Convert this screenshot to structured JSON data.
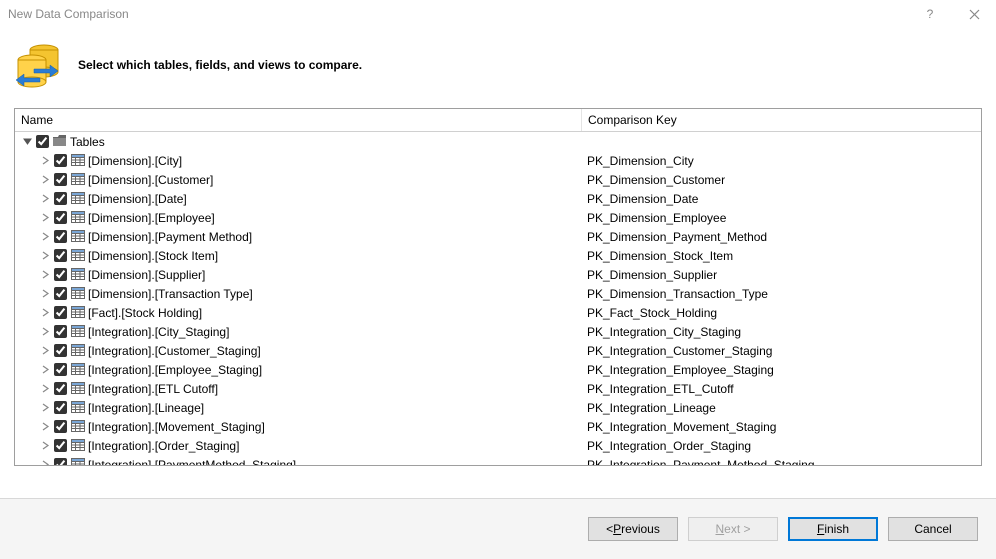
{
  "window": {
    "title": "New Data Comparison",
    "help_tooltip": "?",
    "close_tooltip": "×"
  },
  "intro": {
    "caption": "Select which tables, fields, and views to compare."
  },
  "grid": {
    "col_name": "Name",
    "col_key": "Comparison Key",
    "group_label": "Tables",
    "rows": [
      {
        "name": "[Dimension].[City]",
        "key": "PK_Dimension_City"
      },
      {
        "name": "[Dimension].[Customer]",
        "key": "PK_Dimension_Customer"
      },
      {
        "name": "[Dimension].[Date]",
        "key": "PK_Dimension_Date"
      },
      {
        "name": "[Dimension].[Employee]",
        "key": "PK_Dimension_Employee"
      },
      {
        "name": "[Dimension].[Payment Method]",
        "key": "PK_Dimension_Payment_Method"
      },
      {
        "name": "[Dimension].[Stock Item]",
        "key": "PK_Dimension_Stock_Item"
      },
      {
        "name": "[Dimension].[Supplier]",
        "key": "PK_Dimension_Supplier"
      },
      {
        "name": "[Dimension].[Transaction Type]",
        "key": "PK_Dimension_Transaction_Type"
      },
      {
        "name": "[Fact].[Stock Holding]",
        "key": "PK_Fact_Stock_Holding"
      },
      {
        "name": "[Integration].[City_Staging]",
        "key": "PK_Integration_City_Staging"
      },
      {
        "name": "[Integration].[Customer_Staging]",
        "key": "PK_Integration_Customer_Staging"
      },
      {
        "name": "[Integration].[Employee_Staging]",
        "key": "PK_Integration_Employee_Staging"
      },
      {
        "name": "[Integration].[ETL Cutoff]",
        "key": "PK_Integration_ETL_Cutoff"
      },
      {
        "name": "[Integration].[Lineage]",
        "key": "PK_Integration_Lineage"
      },
      {
        "name": "[Integration].[Movement_Staging]",
        "key": "PK_Integration_Movement_Staging"
      },
      {
        "name": "[Integration].[Order_Staging]",
        "key": "PK_Integration_Order_Staging"
      },
      {
        "name": "[Integration].[PaymentMethod_Staging]",
        "key": "PK_Integration_Payment_Method_Staging"
      }
    ]
  },
  "buttons": {
    "previous_lead": "< ",
    "previous_u": "P",
    "previous_rest": "revious",
    "next_u": "N",
    "next_rest": "ext >",
    "finish_u": "F",
    "finish_rest": "inish",
    "cancel": "Cancel"
  }
}
